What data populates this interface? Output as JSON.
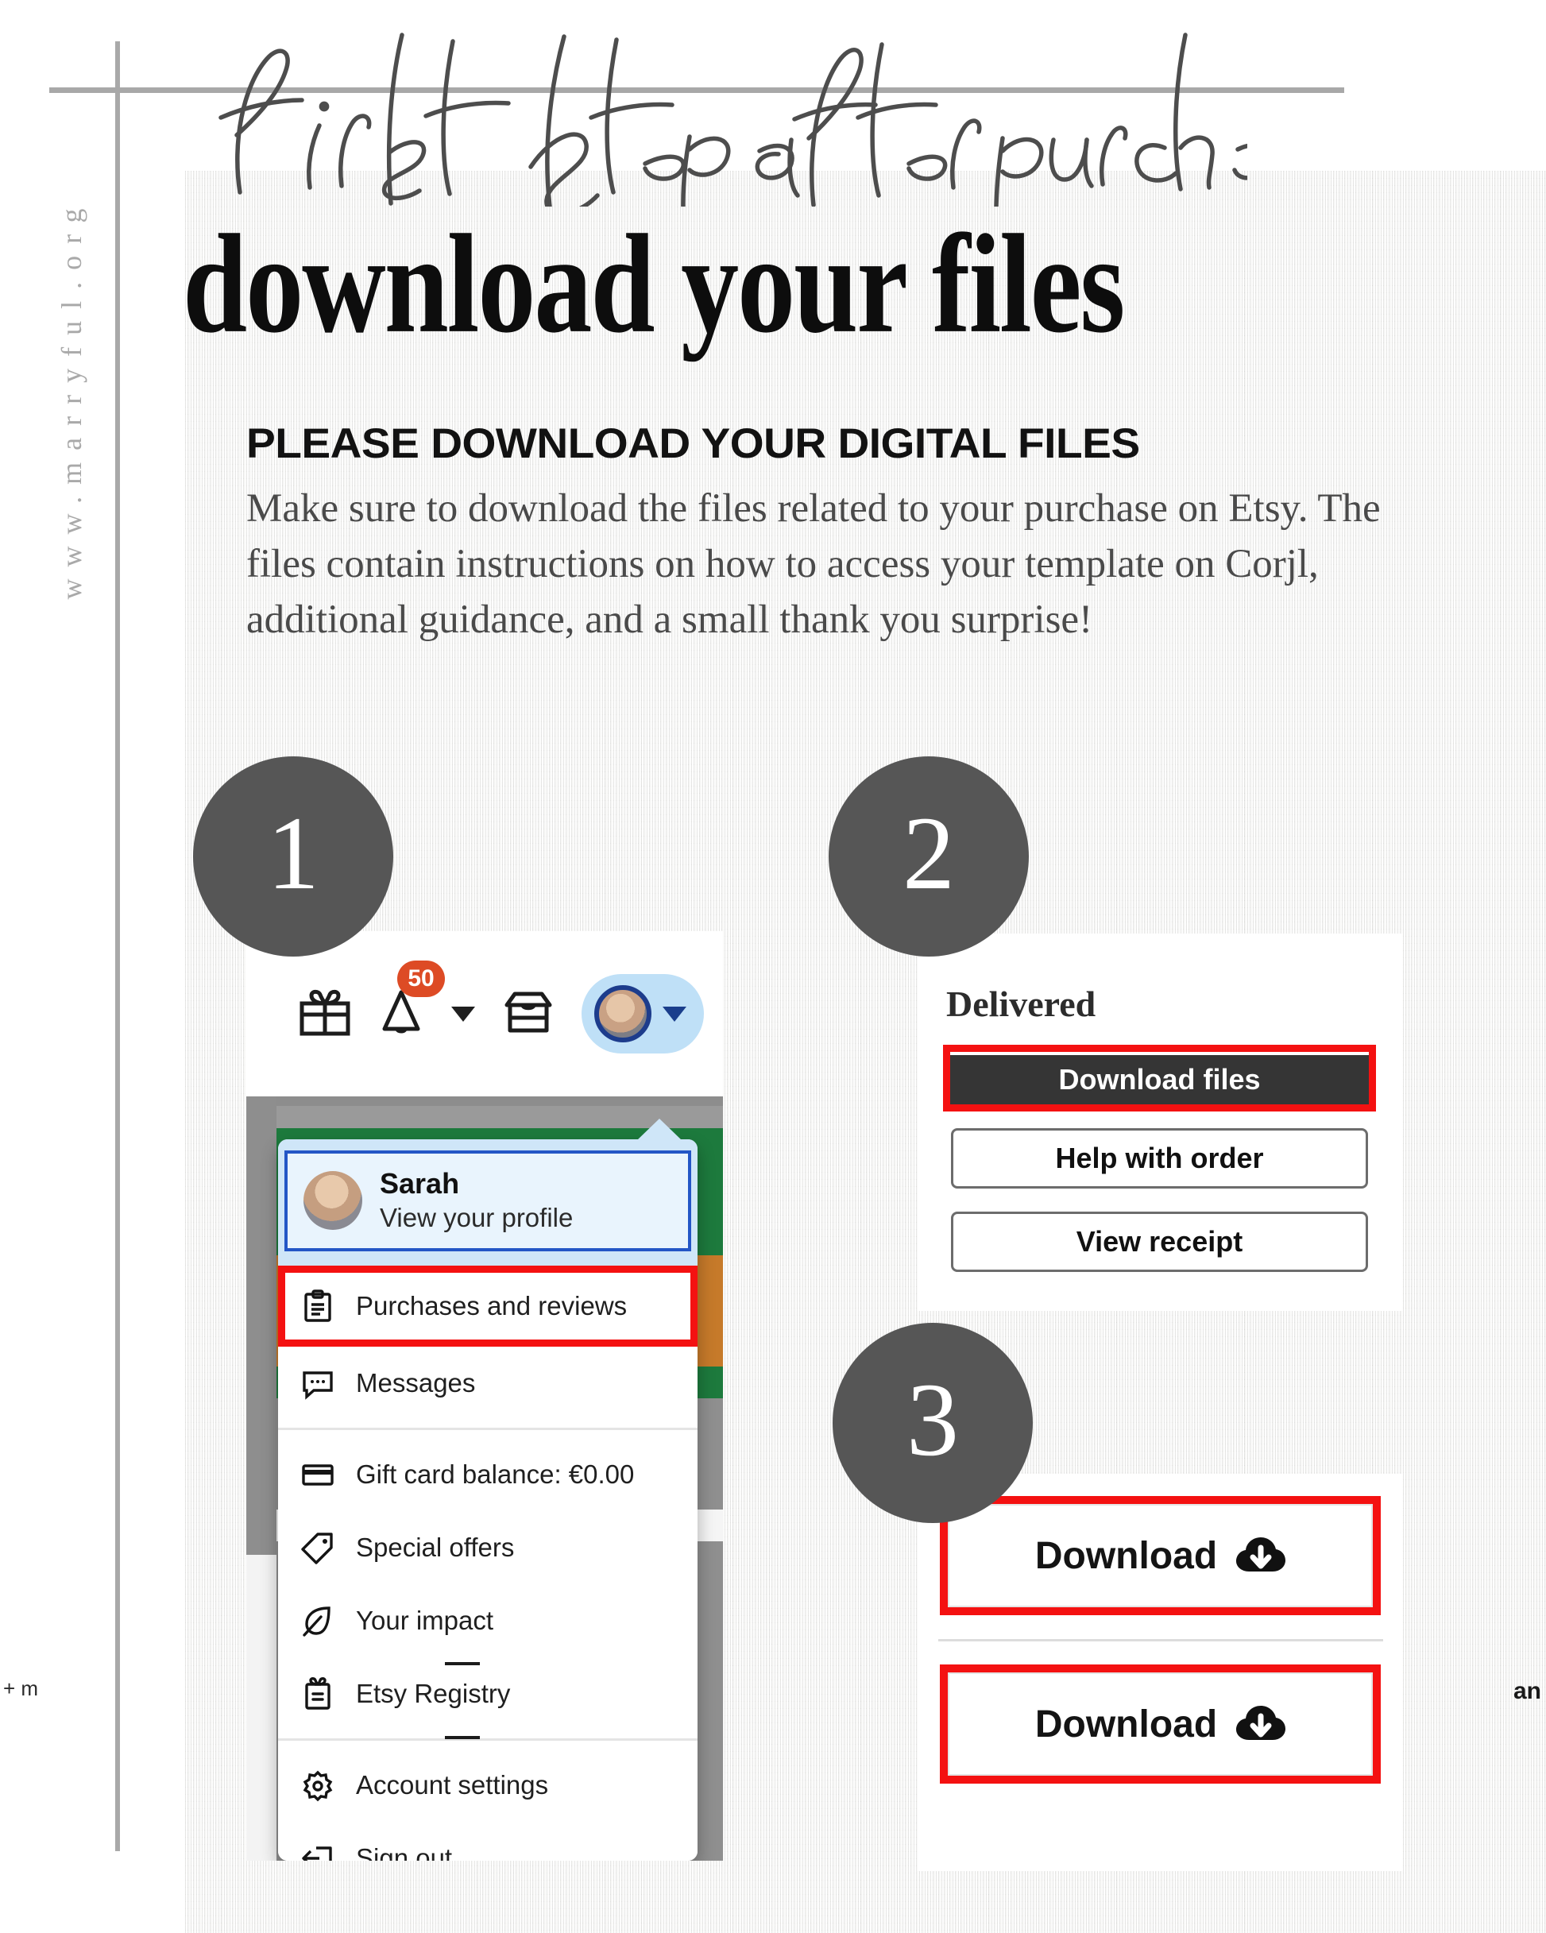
{
  "site": {
    "url": "www.marryful.org"
  },
  "header": {
    "script_title": "first step after purchase:",
    "main_title": "download your files",
    "subhead": "PLEASE DOWNLOAD YOUR DIGITAL FILES",
    "body": "Make sure to download the files related to your purchase on Etsy. The files contain instructions on how to access your template on Corjl, additional guidance, and a small thank you surprise!"
  },
  "colors": {
    "highlight_red": "#f41111",
    "step_circle_gray": "#565656",
    "dark_button": "#353535",
    "etsy_badge_orange": "#dd4b25",
    "etsy_blue": "#2356c6",
    "avatar_pill_blue": "#bfe0f7",
    "rule_gray": "#a8a8a8"
  },
  "steps": [
    {
      "number": "1"
    },
    {
      "number": "2"
    },
    {
      "number": "3"
    }
  ],
  "step1": {
    "nav": {
      "gift_icon": "gift-icon",
      "bell_icon": "bell-icon",
      "bell_badge": "50",
      "bell_caret": "chevron-down-icon",
      "shop_icon": "shop-icon",
      "avatar_icon": "avatar",
      "avatar_caret": "chevron-down-icon"
    },
    "profile": {
      "name": "Sarah",
      "subtitle": "View your profile"
    },
    "menu": [
      {
        "label": "Purchases and reviews",
        "icon": "clipboard-icon",
        "highlighted": true
      },
      {
        "label": "Messages",
        "icon": "message-bubble-icon",
        "highlighted": false
      },
      {
        "label": "Gift card balance: €0.00",
        "icon": "credit-card-icon",
        "highlighted": false
      },
      {
        "label": "Special offers",
        "icon": "tag-icon",
        "highlighted": false
      },
      {
        "label": "Your impact",
        "icon": "leaf-icon",
        "highlighted": false
      },
      {
        "label": "Etsy Registry",
        "icon": "registry-gift-icon",
        "highlighted": false
      },
      {
        "label": "Account settings",
        "icon": "gear-icon",
        "highlighted": false
      },
      {
        "label": "Sign out",
        "icon": "sign-out-icon",
        "highlighted": false
      }
    ],
    "background_fragments": {
      "left": "+ m",
      "right": "an"
    }
  },
  "step2": {
    "status": "Delivered",
    "primary_button": "Download files",
    "buttons": [
      "Help with order",
      "View receipt"
    ]
  },
  "step3": {
    "buttons": [
      {
        "label": "Download",
        "icon": "cloud-download-icon"
      },
      {
        "label": "Download",
        "icon": "cloud-download-icon"
      }
    ]
  }
}
